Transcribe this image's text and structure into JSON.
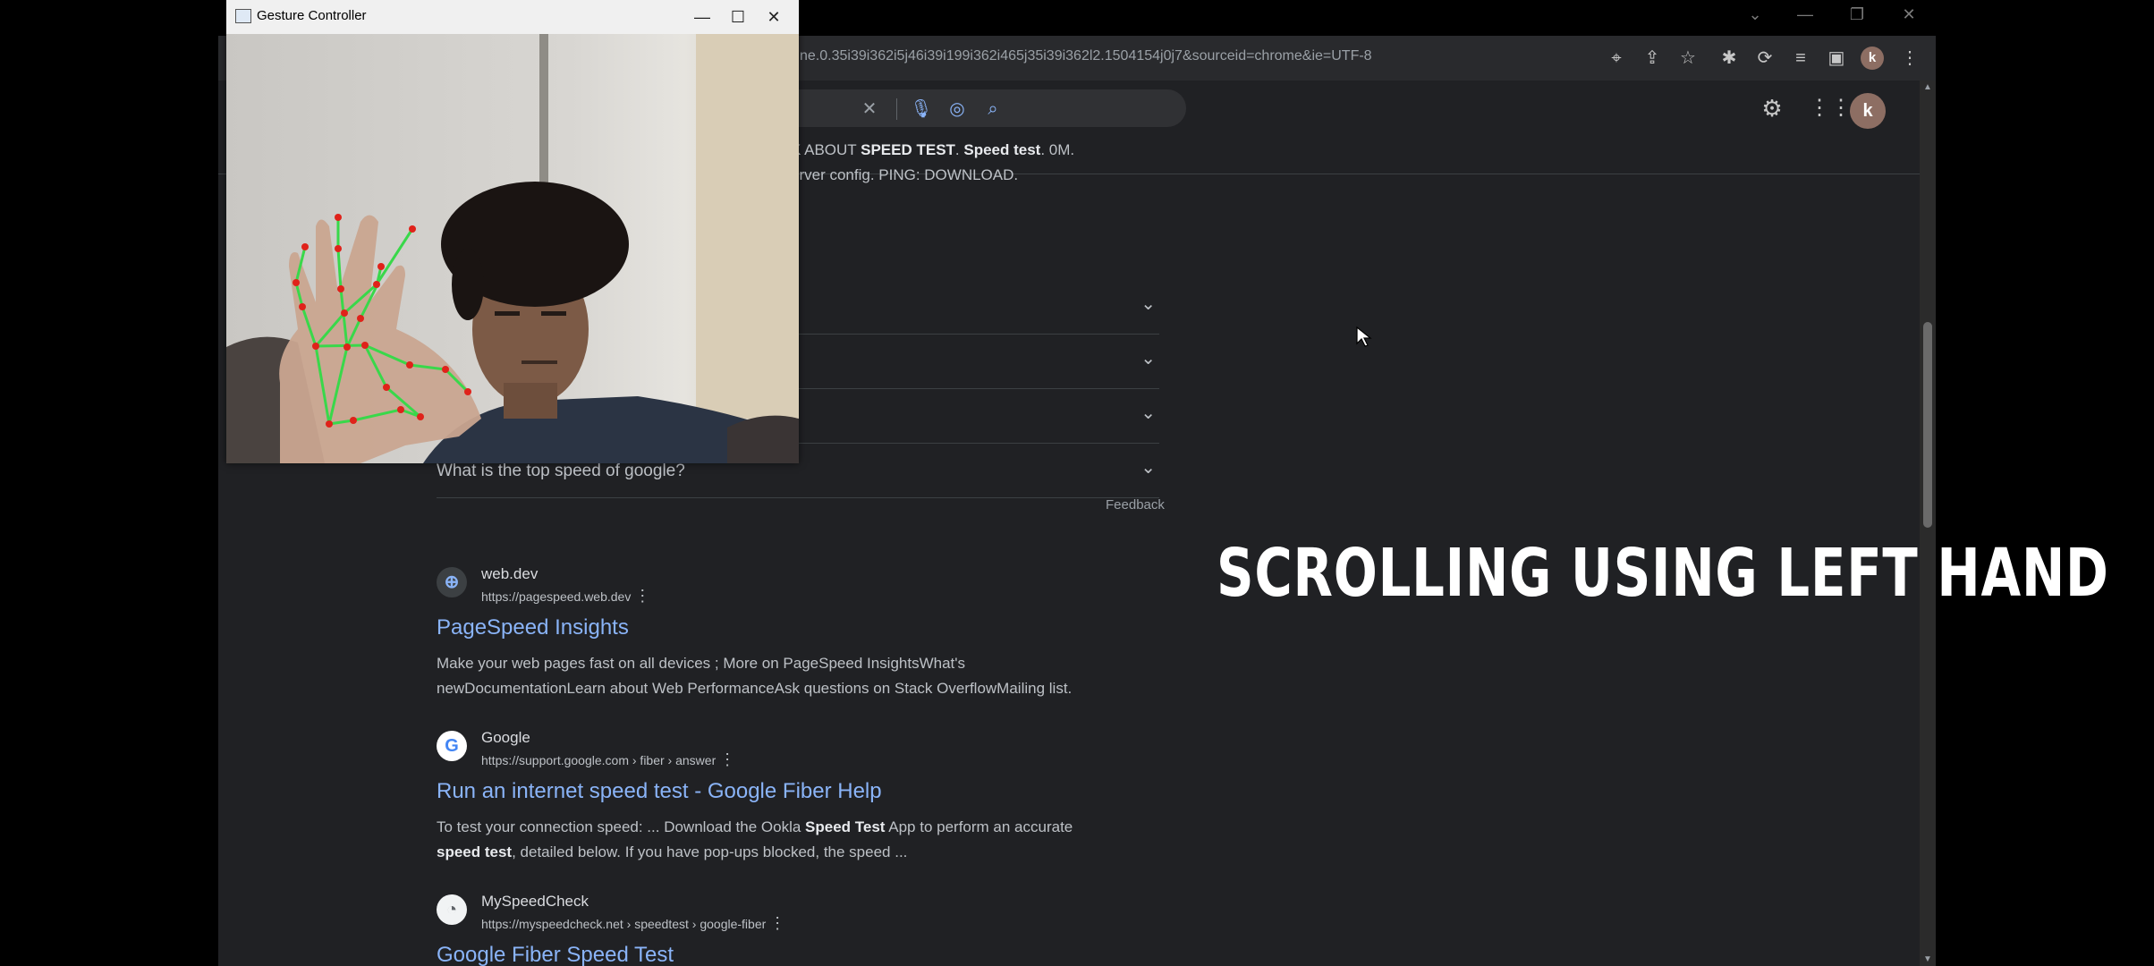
{
  "camera_window": {
    "title": "Gesture Controller",
    "controls": {
      "minimize": "—",
      "maximize": "☐",
      "close": "✕"
    }
  },
  "browser": {
    "url": "ne.0.35i39i362i5j46i39i199i362i465j35i39i362l2.1504154j0j7&sourceid=chrome&ie=UTF-8",
    "avatar_letter": "k"
  },
  "top_snippet": {
    "line1_pre": "K ABOUT ",
    "line1_b1": "SPEED TEST",
    "line1_mid": ". ",
    "line1_b2": "Speed test",
    "line1_post": ". 0M.",
    "line2": "erver config. PING: DOWNLOAD."
  },
  "faq": {
    "visible_question": "What is the top speed of google?",
    "feedback": "Feedback"
  },
  "results": [
    {
      "site": "web.dev",
      "url": "https://pagespeed.web.dev",
      "title": "PageSpeed Insights",
      "snippet_line1": "Make your web pages fast on all devices ; More on PageSpeed InsightsWhat's",
      "snippet_line2": "newDocumentationLearn about Web PerformanceAsk questions on Stack OverflowMailing list."
    },
    {
      "site": "Google",
      "url": "https://support.google.com › fiber › answer",
      "title": "Run an internet speed test - Google Fiber Help",
      "snippet_line1_pre": "To test your connection speed: ... Download the Ookla ",
      "snippet_line1_b": "Speed Test",
      "snippet_line1_post": " App to perform an accurate",
      "snippet_line2_b": "speed test",
      "snippet_line2_post": ", detailed below. If you have pop-ups blocked, the speed ..."
    },
    {
      "site": "MySpeedCheck",
      "url": "https://myspeedcheck.net › speedtest › google-fiber",
      "title": "Google Fiber Speed Test"
    }
  ],
  "overlay_caption": "SCROLLING USING LEFT HAND"
}
